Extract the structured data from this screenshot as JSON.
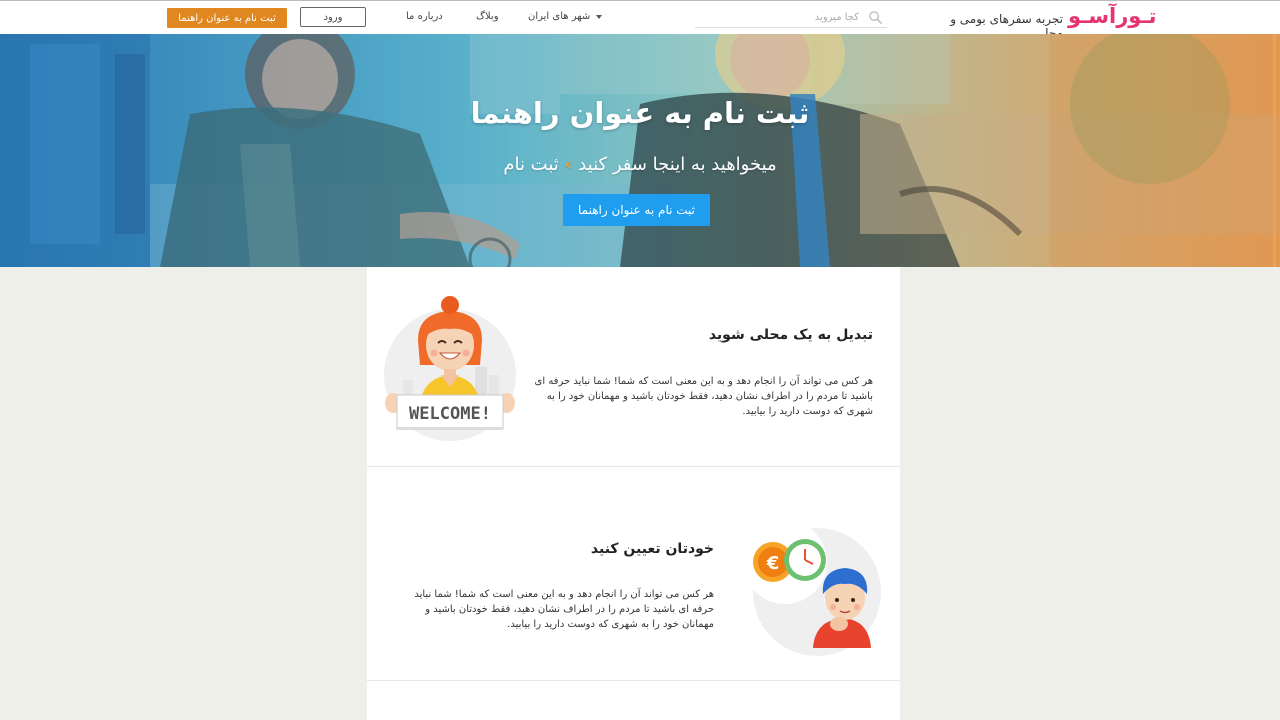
{
  "header": {
    "logo": "تـورآسـو",
    "tagline": "تجربه سفرهای بومی و محلی",
    "search_placeholder": "کجا میروید",
    "nav_cities": "شهر های ایران",
    "nav_blog": "وبلاگ",
    "nav_about": "درباره ما",
    "login_label": "ورود",
    "register_label": "ثبت نام به عنوان راهنما"
  },
  "hero": {
    "title": "ثبت نام به عنوان راهنما",
    "breadcrumb_prefix": "میخواهید به اینجا سفر کنید",
    "breadcrumb_sep": "›",
    "breadcrumb_current": "ثبت نام",
    "cta_label": "ثبت نام به عنوان راهنما"
  },
  "features": [
    {
      "title": "تبدیل به یک محلی شوید",
      "body": "هر کس می تواند آن را انجام دهد و به این معنی است که شما! شما نباید حرفه ای باشید تا مردم را در اطراف نشان دهید، فقط خودتان باشید و مهمانان خود را به شهری که دوست دارید را بیابید.",
      "illustration_text": "WELCOME!"
    },
    {
      "title": "خودتان تعیین کنید",
      "body": "هر کس می تواند آن را انجام دهد و به این معنی است که شما! شما نباید حرفه ای باشید تا مردم را در اطراف نشان دهید، فقط خودتان باشید و مهمانان خود را به شهری که دوست دارید را بیابید."
    }
  ],
  "colors": {
    "brand": "#e5346e",
    "register_orange": "#e0871f",
    "cta_blue": "#1f9ef0",
    "page_bg": "#efefea"
  }
}
